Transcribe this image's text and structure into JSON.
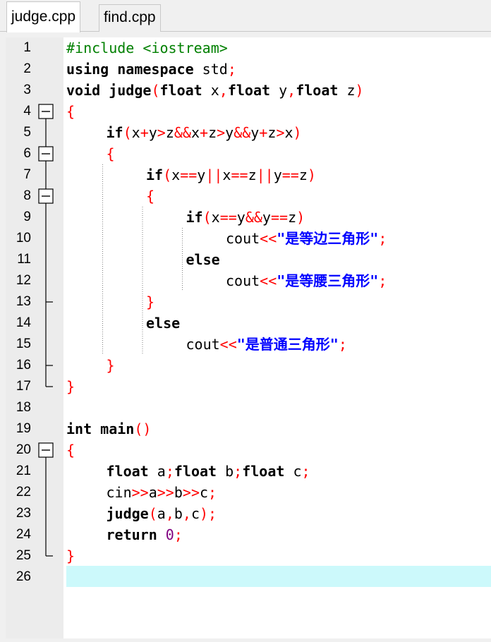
{
  "tabs": [
    {
      "label": "judge.cpp",
      "active": true
    },
    {
      "label": "find.cpp",
      "active": false
    }
  ],
  "colors": {
    "keyword": "#000000",
    "operator": "#ff0000",
    "preprocessor": "#008000",
    "number": "#800080",
    "string": "#0000ff",
    "current_line": "#ccf9fb",
    "gutter": "#ececec"
  },
  "editor": {
    "current_line": 26,
    "fold_markers": [
      {
        "line": 4,
        "state": "expanded"
      },
      {
        "line": 6,
        "state": "expanded"
      },
      {
        "line": 8,
        "state": "expanded"
      },
      {
        "line": 20,
        "state": "expanded"
      }
    ],
    "lines": [
      {
        "n": "1",
        "indent": 0,
        "tokens": [
          {
            "t": "#include <iostream>",
            "c": "pp"
          }
        ]
      },
      {
        "n": "2",
        "indent": 0,
        "tokens": [
          {
            "t": "using",
            "c": "kw"
          },
          {
            "t": " ",
            "c": "ws"
          },
          {
            "t": "namespace",
            "c": "kw"
          },
          {
            "t": " std",
            "c": "id"
          },
          {
            "t": ";",
            "c": "op"
          }
        ]
      },
      {
        "n": "3",
        "indent": 0,
        "tokens": [
          {
            "t": "void",
            "c": "kw"
          },
          {
            "t": " ",
            "c": "ws"
          },
          {
            "t": "judge",
            "c": "kw"
          },
          {
            "t": "(",
            "c": "op"
          },
          {
            "t": "float",
            "c": "kw"
          },
          {
            "t": " x",
            "c": "id"
          },
          {
            "t": ",",
            "c": "op"
          },
          {
            "t": "float",
            "c": "kw"
          },
          {
            "t": " y",
            "c": "id"
          },
          {
            "t": ",",
            "c": "op"
          },
          {
            "t": "float",
            "c": "kw"
          },
          {
            "t": " z",
            "c": "id"
          },
          {
            "t": ")",
            "c": "op"
          }
        ]
      },
      {
        "n": "4",
        "indent": 0,
        "tokens": [
          {
            "t": "{",
            "c": "op"
          }
        ]
      },
      {
        "n": "5",
        "indent": 1,
        "tokens": [
          {
            "t": "if",
            "c": "kw"
          },
          {
            "t": "(",
            "c": "op"
          },
          {
            "t": "x",
            "c": "id"
          },
          {
            "t": "+",
            "c": "op"
          },
          {
            "t": "y",
            "c": "id"
          },
          {
            "t": ">",
            "c": "op"
          },
          {
            "t": "z",
            "c": "id"
          },
          {
            "t": "&&",
            "c": "op"
          },
          {
            "t": "x",
            "c": "id"
          },
          {
            "t": "+",
            "c": "op"
          },
          {
            "t": "z",
            "c": "id"
          },
          {
            "t": ">",
            "c": "op"
          },
          {
            "t": "y",
            "c": "id"
          },
          {
            "t": "&&",
            "c": "op"
          },
          {
            "t": "y",
            "c": "id"
          },
          {
            "t": "+",
            "c": "op"
          },
          {
            "t": "z",
            "c": "id"
          },
          {
            "t": ">",
            "c": "op"
          },
          {
            "t": "x",
            "c": "id"
          },
          {
            "t": ")",
            "c": "op"
          }
        ]
      },
      {
        "n": "6",
        "indent": 1,
        "tokens": [
          {
            "t": "{",
            "c": "op"
          }
        ]
      },
      {
        "n": "7",
        "indent": 2,
        "tokens": [
          {
            "t": "if",
            "c": "kw"
          },
          {
            "t": "(",
            "c": "op"
          },
          {
            "t": "x",
            "c": "id"
          },
          {
            "t": "==",
            "c": "op"
          },
          {
            "t": "y",
            "c": "id"
          },
          {
            "t": "||",
            "c": "op"
          },
          {
            "t": "x",
            "c": "id"
          },
          {
            "t": "==",
            "c": "op"
          },
          {
            "t": "z",
            "c": "id"
          },
          {
            "t": "||",
            "c": "op"
          },
          {
            "t": "y",
            "c": "id"
          },
          {
            "t": "==",
            "c": "op"
          },
          {
            "t": "z",
            "c": "id"
          },
          {
            "t": ")",
            "c": "op"
          }
        ]
      },
      {
        "n": "8",
        "indent": 2,
        "tokens": [
          {
            "t": "{",
            "c": "op"
          }
        ]
      },
      {
        "n": "9",
        "indent": 3,
        "tokens": [
          {
            "t": "if",
            "c": "kw"
          },
          {
            "t": "(",
            "c": "op"
          },
          {
            "t": "x",
            "c": "id"
          },
          {
            "t": "==",
            "c": "op"
          },
          {
            "t": "y",
            "c": "id"
          },
          {
            "t": "&&",
            "c": "op"
          },
          {
            "t": "y",
            "c": "id"
          },
          {
            "t": "==",
            "c": "op"
          },
          {
            "t": "z",
            "c": "id"
          },
          {
            "t": ")",
            "c": "op"
          }
        ]
      },
      {
        "n": "10",
        "indent": 4,
        "tokens": [
          {
            "t": "cout",
            "c": "id"
          },
          {
            "t": "<<",
            "c": "op"
          },
          {
            "t": "\"是等边三角形\"",
            "c": "str"
          },
          {
            "t": ";",
            "c": "op"
          }
        ]
      },
      {
        "n": "11",
        "indent": 3,
        "tokens": [
          {
            "t": "else",
            "c": "kw"
          }
        ]
      },
      {
        "n": "12",
        "indent": 4,
        "tokens": [
          {
            "t": "cout",
            "c": "id"
          },
          {
            "t": "<<",
            "c": "op"
          },
          {
            "t": "\"是等腰三角形\"",
            "c": "str"
          },
          {
            "t": ";",
            "c": "op"
          }
        ]
      },
      {
        "n": "13",
        "indent": 2,
        "tokens": [
          {
            "t": "}",
            "c": "op"
          }
        ]
      },
      {
        "n": "14",
        "indent": 2,
        "tokens": [
          {
            "t": "else",
            "c": "kw"
          }
        ]
      },
      {
        "n": "15",
        "indent": 3,
        "tokens": [
          {
            "t": "cout",
            "c": "id"
          },
          {
            "t": "<<",
            "c": "op"
          },
          {
            "t": "\"是普通三角形\"",
            "c": "str"
          },
          {
            "t": ";",
            "c": "op"
          }
        ]
      },
      {
        "n": "16",
        "indent": 1,
        "tokens": [
          {
            "t": "}",
            "c": "op"
          }
        ]
      },
      {
        "n": "17",
        "indent": 0,
        "tokens": [
          {
            "t": "}",
            "c": "op"
          }
        ]
      },
      {
        "n": "18",
        "indent": 0,
        "tokens": []
      },
      {
        "n": "19",
        "indent": 0,
        "tokens": [
          {
            "t": "int",
            "c": "kw"
          },
          {
            "t": " ",
            "c": "ws"
          },
          {
            "t": "main",
            "c": "kw"
          },
          {
            "t": "()",
            "c": "op"
          }
        ]
      },
      {
        "n": "20",
        "indent": 0,
        "tokens": [
          {
            "t": "{",
            "c": "op"
          }
        ]
      },
      {
        "n": "21",
        "indent": 1,
        "tokens": [
          {
            "t": "float",
            "c": "kw"
          },
          {
            "t": " a",
            "c": "id"
          },
          {
            "t": ";",
            "c": "op"
          },
          {
            "t": "float",
            "c": "kw"
          },
          {
            "t": " b",
            "c": "id"
          },
          {
            "t": ";",
            "c": "op"
          },
          {
            "t": "float",
            "c": "kw"
          },
          {
            "t": " c",
            "c": "id"
          },
          {
            "t": ";",
            "c": "op"
          }
        ]
      },
      {
        "n": "22",
        "indent": 1,
        "tokens": [
          {
            "t": "cin",
            "c": "id"
          },
          {
            "t": ">>",
            "c": "op"
          },
          {
            "t": "a",
            "c": "id"
          },
          {
            "t": ">>",
            "c": "op"
          },
          {
            "t": "b",
            "c": "id"
          },
          {
            "t": ">>",
            "c": "op"
          },
          {
            "t": "c",
            "c": "id"
          },
          {
            "t": ";",
            "c": "op"
          }
        ]
      },
      {
        "n": "23",
        "indent": 1,
        "tokens": [
          {
            "t": "judge",
            "c": "kw"
          },
          {
            "t": "(",
            "c": "op"
          },
          {
            "t": "a",
            "c": "id"
          },
          {
            "t": ",",
            "c": "op"
          },
          {
            "t": "b",
            "c": "id"
          },
          {
            "t": ",",
            "c": "op"
          },
          {
            "t": "c",
            "c": "id"
          },
          {
            "t": ");",
            "c": "op"
          }
        ]
      },
      {
        "n": "24",
        "indent": 1,
        "tokens": [
          {
            "t": "return",
            "c": "kw"
          },
          {
            "t": " ",
            "c": "ws"
          },
          {
            "t": "0",
            "c": "num"
          },
          {
            "t": ";",
            "c": "op"
          }
        ]
      },
      {
        "n": "25",
        "indent": 0,
        "tokens": [
          {
            "t": "}",
            "c": "op"
          }
        ]
      },
      {
        "n": "26",
        "indent": 0,
        "tokens": []
      }
    ]
  }
}
